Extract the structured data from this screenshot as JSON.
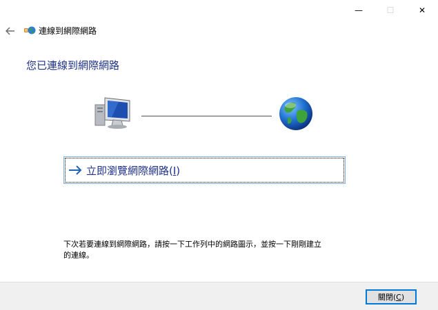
{
  "window": {
    "caption_buttons": {
      "minimize_glyph": "—",
      "maximize_glyph": "☐",
      "close_glyph": "✕"
    }
  },
  "header": {
    "back_icon": "back-arrow-icon",
    "app_icon": "network-globe-icon",
    "title": "連線到網際網路"
  },
  "main": {
    "heading": "您已連線到網際網路",
    "diagram": {
      "left_icon": "computer-icon",
      "right_icon": "globe-icon"
    },
    "command_link": {
      "arrow_icon": "right-arrow-icon",
      "label_prefix": "立即瀏覽網際網路(",
      "access_key": "I",
      "label_suffix": ")"
    },
    "info_text": "下次若要連線到網際網路，請按一下工作列中的網路圖示，並按一下剛剛建立的連線。"
  },
  "footer": {
    "close_button": {
      "label_prefix": "關閉(",
      "access_key": "C",
      "label_suffix": ")"
    }
  },
  "colors": {
    "heading_blue": "#1e3287",
    "accent_blue": "#0078d7",
    "footer_bg": "#f0f0f0"
  }
}
